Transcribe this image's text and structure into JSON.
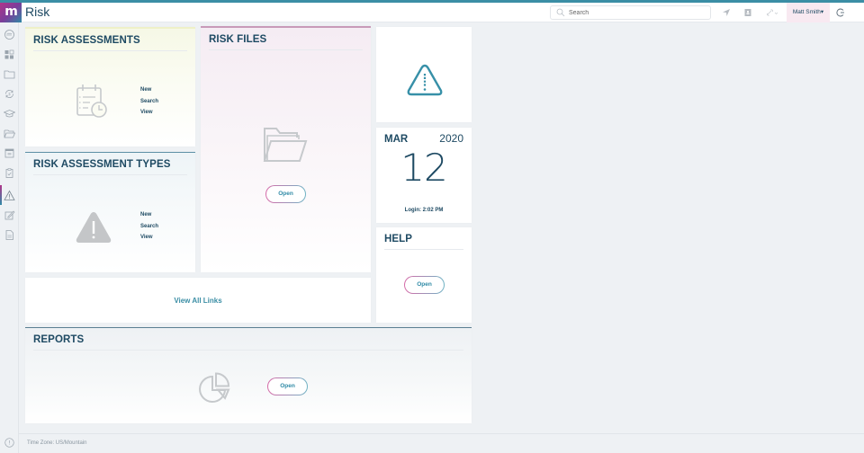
{
  "header": {
    "app_title": "Risk",
    "logo_glyph": "m",
    "search_placeholder": "Search",
    "user_menu_label": "Matt Smith▾",
    "icons": [
      "location-arrow-icon",
      "address-book-icon",
      "link-dropdown-icon",
      "logout-icon"
    ]
  },
  "sidebar": {
    "items": [
      {
        "name": "home-logo-icon"
      },
      {
        "name": "dashboard-icon"
      },
      {
        "name": "folder-icon"
      },
      {
        "name": "refresh-icon"
      },
      {
        "name": "training-icon"
      },
      {
        "name": "folder-open-icon"
      },
      {
        "name": "calendar-icon"
      },
      {
        "name": "clipboard-check-icon"
      },
      {
        "name": "risk-warning-icon",
        "active": true
      },
      {
        "name": "edit-icon"
      },
      {
        "name": "document-icon"
      }
    ]
  },
  "cards": {
    "risk_assessments": {
      "title": "RISK ASSESSMENTS",
      "links": [
        "New",
        "Search",
        "View"
      ]
    },
    "risk_assessment_types": {
      "title": "RISK ASSESSMENT TYPES",
      "links": [
        "New",
        "Search",
        "View"
      ]
    },
    "risk_files": {
      "title": "RISK FILES",
      "button": "Open"
    },
    "date": {
      "month": "MAR",
      "year": "2020",
      "day": "12",
      "login": "Login: 2:02 PM"
    },
    "help": {
      "title": "HELP",
      "button": "Open"
    },
    "links": {
      "label": "View All Links"
    },
    "reports": {
      "title": "REPORTS",
      "button": "Open"
    }
  },
  "footer": {
    "timezone": "Time Zone: US/Mountain"
  },
  "colors": {
    "accent": "#2f8aa6",
    "heading": "#1e4a63",
    "brand_pink": "#b0358a",
    "background": "#eef1f4"
  }
}
